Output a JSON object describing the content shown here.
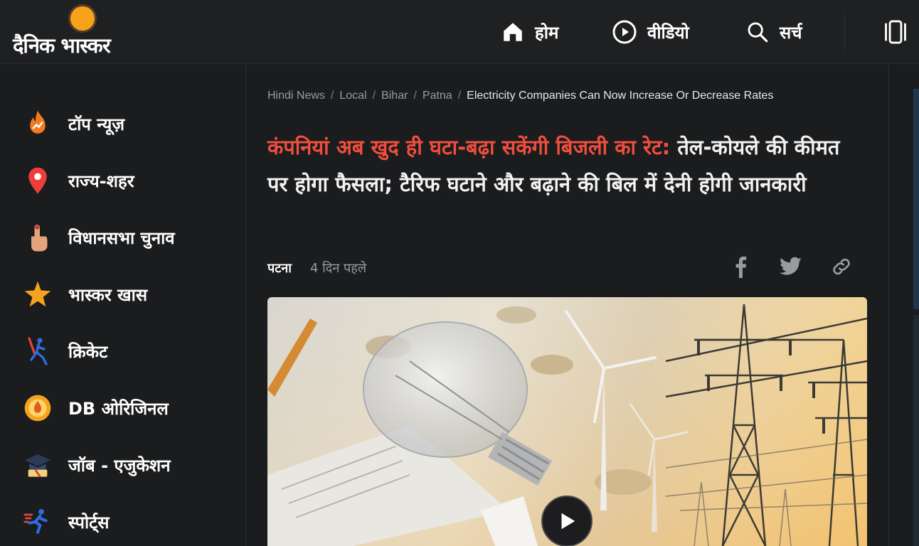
{
  "brand": {
    "logo_text": "दैनिक भास्कर"
  },
  "nav": {
    "home_label": "होम",
    "video_label": "वीडियो",
    "search_label": "सर्च"
  },
  "sidebar": {
    "items": [
      {
        "label": "टॉप न्यूज़",
        "icon": "fire-trend-icon"
      },
      {
        "label": "राज्य-शहर",
        "icon": "location-pin-icon"
      },
      {
        "label": "विधानसभा चुनाव",
        "icon": "vote-finger-icon"
      },
      {
        "label": "भास्कर खास",
        "icon": "star-icon"
      },
      {
        "label": "क्रिकेट",
        "icon": "cricket-icon"
      },
      {
        "label": "DB ओरिजिनल",
        "icon": "db-original-icon"
      },
      {
        "label": "जॉब - एजुकेशन",
        "icon": "graduation-cap-icon"
      },
      {
        "label": "स्पोर्ट्स",
        "icon": "runner-icon"
      }
    ]
  },
  "breadcrumb": [
    {
      "label": "Hindi News"
    },
    {
      "label": "Local"
    },
    {
      "label": "Bihar"
    },
    {
      "label": "Patna"
    },
    {
      "label": "Electricity Companies Can Now Increase Or Decrease Rates"
    }
  ],
  "article": {
    "headline_highlight": "कंपनियां अब खुद ही घटा-बढ़ा सकेंगी बिजली का रेट:",
    "headline_rest": " तेल-कोयले की कीमत पर होगा फैसला; टैरिफ घटाने और बढ़ाने की बिल में देनी होगी जानकारी",
    "city": "पटना",
    "time": "4 दिन पहले"
  },
  "colors": {
    "accent": "#f04e3e",
    "sun": "#f7a21b",
    "background": "#1b1c1e"
  }
}
